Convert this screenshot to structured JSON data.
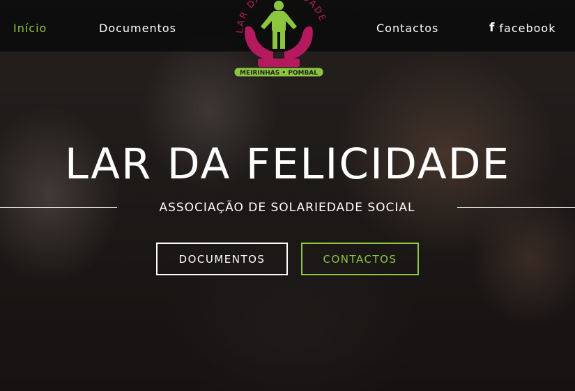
{
  "nav": {
    "items": [
      {
        "label": "Início",
        "active": true
      },
      {
        "label": "Documentos",
        "active": false
      },
      {
        "label": "Contactos",
        "active": false
      },
      {
        "label": "facebook",
        "active": false
      }
    ],
    "facebook_icon": "facebook-f-icon"
  },
  "logo": {
    "arc_text": "LAR DA FELICIDADE",
    "banner": "MEIRINHAS • POMBAL"
  },
  "hero": {
    "title": "LAR DA FELICIDADE",
    "subtitle": "ASSOCIAÇÃO DE SOLARIEDADE SOCIAL",
    "buttons": {
      "documents": "DOCUMENTOS",
      "contacts": "CONTACTOS"
    }
  },
  "colors": {
    "accent": "#8cc63f",
    "logo_magenta": "#b5195e",
    "logo_green": "#8cc63f",
    "navbar_bg": "#0a0a0a",
    "text": "#ffffff"
  }
}
